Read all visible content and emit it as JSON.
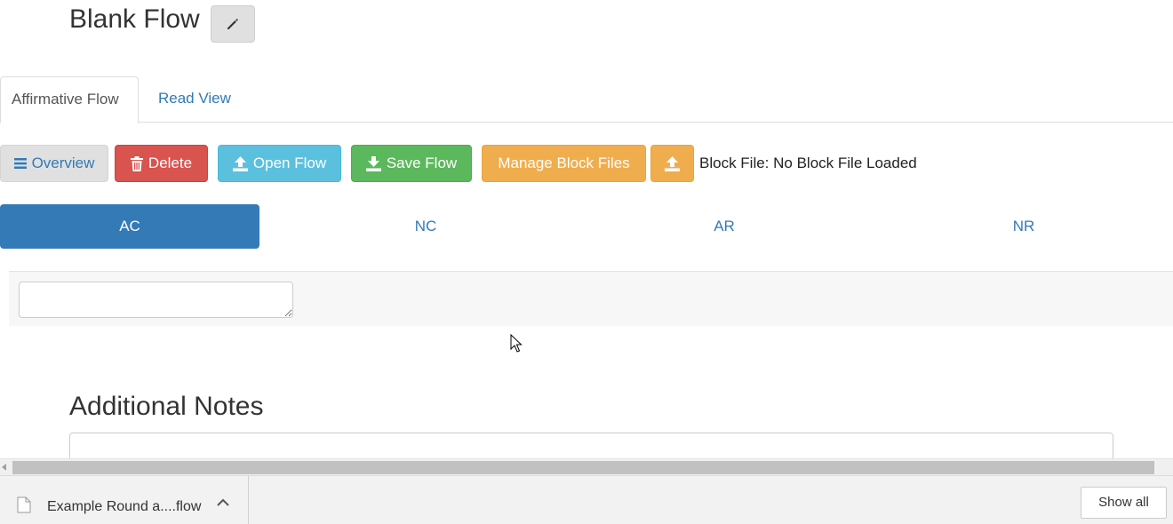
{
  "header": {
    "title": "Blank Flow",
    "edit_icon": "pencil-icon"
  },
  "tabs": [
    {
      "label": "Affirmative Flow",
      "active": true
    },
    {
      "label": "Read View",
      "active": false
    }
  ],
  "toolbar": {
    "overview_label": "Overview",
    "delete_label": "Delete",
    "open_label": "Open Flow",
    "save_label": "Save Flow",
    "manage_label": "Manage Block Files",
    "block_file_text": "Block File: No Block File Loaded"
  },
  "speech_tabs": [
    {
      "label": "AC",
      "active": true
    },
    {
      "label": "NC",
      "active": false
    },
    {
      "label": "AR",
      "active": false
    },
    {
      "label": "NR",
      "active": false
    }
  ],
  "notes": {
    "heading": "Additional Notes"
  },
  "downloads": {
    "file_name": "Example Round a....flow",
    "show_all_label": "Show all"
  },
  "colors": {
    "primary": "#337ab7",
    "danger": "#d9534f",
    "info": "#5bc0de",
    "success": "#5cb85c",
    "warning": "#f0ad4e"
  }
}
